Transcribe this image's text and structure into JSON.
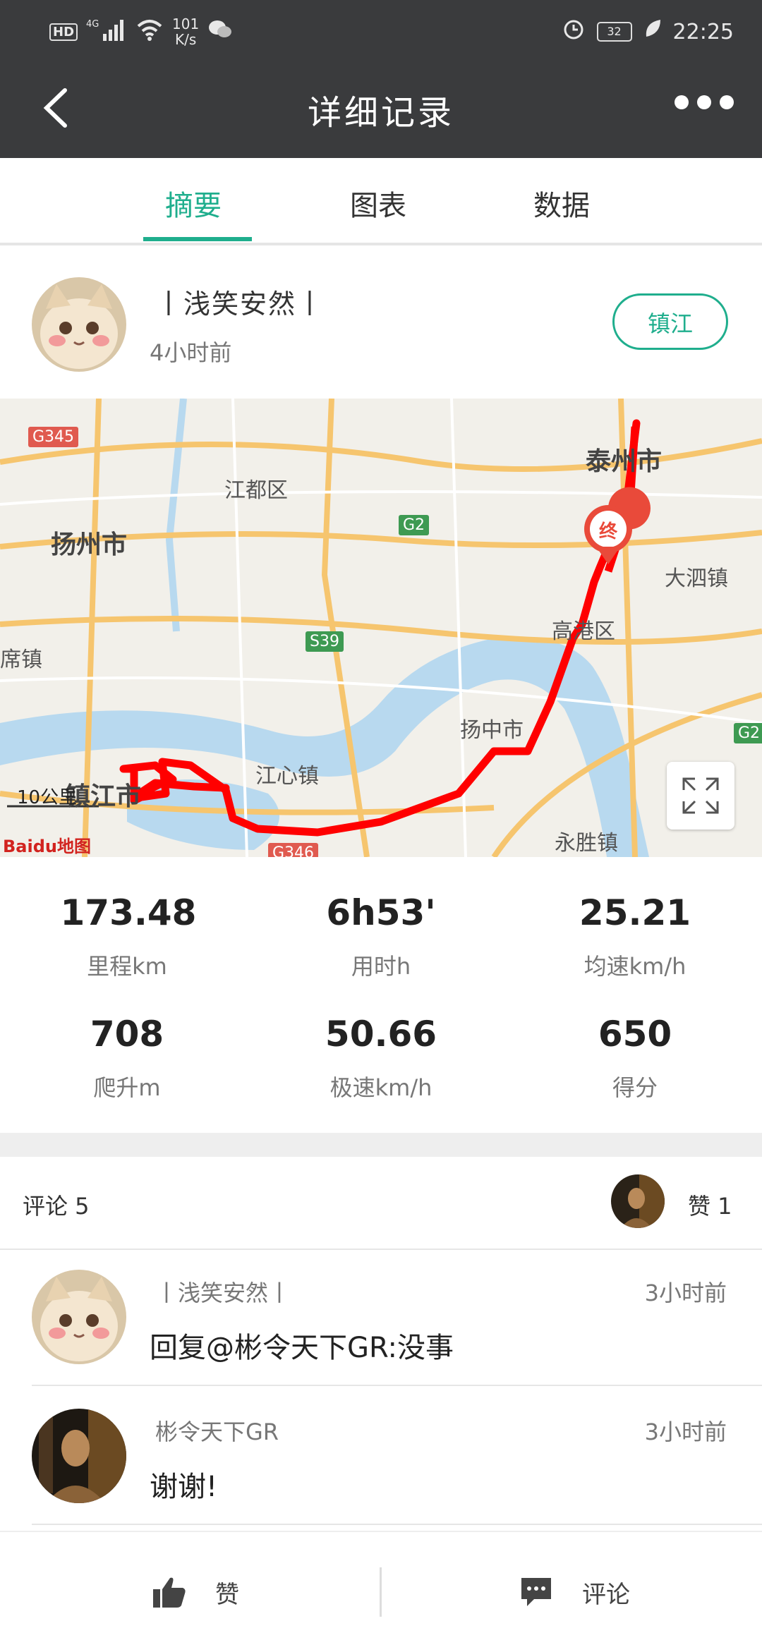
{
  "status_bar": {
    "hd": "HD",
    "network": "4G",
    "speed_value": "101",
    "speed_unit": "K/s",
    "battery": "32",
    "time": "22:25"
  },
  "header": {
    "title": "详细记录"
  },
  "tabs": [
    {
      "label": "摘要",
      "active": true
    },
    {
      "label": "图表",
      "active": false
    },
    {
      "label": "数据",
      "active": false
    }
  ],
  "user": {
    "name": "丨浅笑安然丨",
    "time_ago": "4小时前",
    "city_button": "镇江"
  },
  "map": {
    "labels": {
      "taizhou": "泰州市",
      "yangzhou": "扬州市",
      "jiangdu": "江都区",
      "dasi": "大泗镇",
      "gaogang": "高港区",
      "yangzhong": "扬中市",
      "zhenjiang": "镇江市",
      "jiangxin": "江心镇",
      "yongsheng": "永胜镇",
      "xi": "席镇"
    },
    "roads": {
      "g345": "G345",
      "g2": "G2",
      "s39": "S39",
      "g346": "G346",
      "g2b": "G2"
    },
    "end_marker": "终",
    "scale": "10公里",
    "brand": "Baidu地图",
    "route_color": "#ff0000"
  },
  "stats": [
    {
      "value": "173.48",
      "label": "里程km"
    },
    {
      "value": "6h53'",
      "label": "用时h"
    },
    {
      "value": "25.21",
      "label": "均速km/h"
    },
    {
      "value": "708",
      "label": "爬升m"
    },
    {
      "value": "50.66",
      "label": "极速km/h"
    },
    {
      "value": "650",
      "label": "得分"
    }
  ],
  "comments_section": {
    "comments_label": "评论 5",
    "likes_label": "赞 1"
  },
  "comments": [
    {
      "author": "丨浅笑安然丨",
      "time": "3小时前",
      "text": "回复@彬令天下GR:没事"
    },
    {
      "author": "彬令天下GR",
      "time": "3小时前",
      "text": "谢谢!"
    }
  ],
  "bottom_bar": {
    "like_label": "赞",
    "comment_label": "评论"
  },
  "colors": {
    "accent": "#1fae8d",
    "header_bg": "#3a3b3d"
  }
}
